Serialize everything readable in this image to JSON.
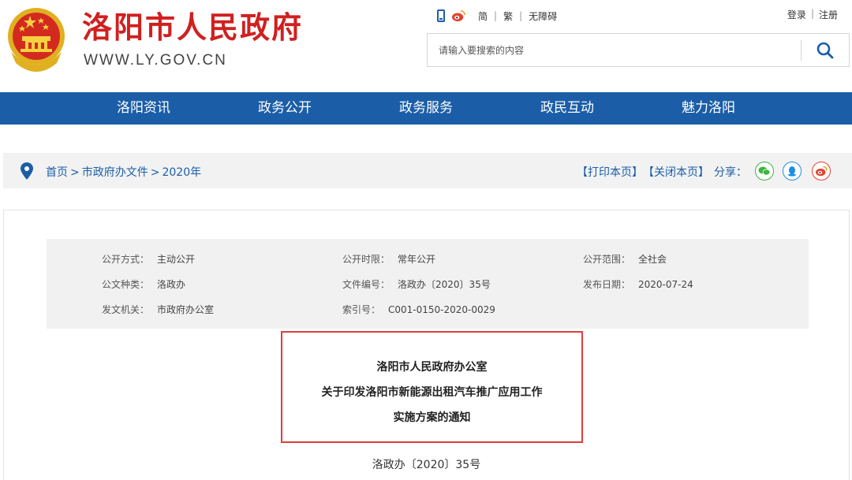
{
  "header": {
    "site_title": "洛阳市人民政府",
    "site_url": "WWW.LY.GOV.CN",
    "top_links": [
      "简",
      "繁",
      "无障碍"
    ],
    "auth": {
      "login": "登录",
      "register": "注册"
    },
    "search": {
      "placeholder": "请输入要搜索的内容"
    }
  },
  "nav": {
    "items": [
      "洛阳资讯",
      "政务公开",
      "政务服务",
      "政民互动",
      "魅力洛阳"
    ]
  },
  "breadcrumb": {
    "items": [
      "首页",
      "市政府办文件",
      "2020年"
    ],
    "separator": ">",
    "print": "【打印本页】",
    "close": "【关闭本页】",
    "share_label": "分享："
  },
  "meta": {
    "rows": [
      [
        {
          "key": "公开方式：",
          "value": "主动公开"
        },
        {
          "key": "公开时限：",
          "value": "常年公开"
        },
        {
          "key": "公开范围：",
          "value": "全社会"
        }
      ],
      [
        {
          "key": "公文种类：",
          "value": "洛政办"
        },
        {
          "key": "文件编号：",
          "value": "洛政办〔2020〕35号"
        },
        {
          "key": "发布日期：",
          "value": "2020-07-24"
        }
      ],
      [
        {
          "key": "发文机关：",
          "value": "市政府办公室"
        },
        {
          "key": "索引号：",
          "value": "C001-0150-2020-0029"
        }
      ]
    ]
  },
  "document": {
    "title_lines": [
      "洛阳市人民政府办公室",
      "关于印发洛阳市新能源出租汽车推广应用工作",
      "实施方案的通知"
    ],
    "doc_number": "洛政办〔2020〕35号"
  },
  "colors": {
    "brand_red": "#d02020",
    "nav_blue": "#1b5ea7",
    "highlight_red": "#e03c3c",
    "wechat_green": "#3db53d",
    "qq_blue": "#1d8fe0",
    "weibo_red": "#e6412f"
  },
  "icons": [
    "national-emblem-icon",
    "phone-icon",
    "weibo-icon",
    "search-icon",
    "location-pin-icon",
    "wechat-icon",
    "qq-icon",
    "weibo-share-icon"
  ]
}
